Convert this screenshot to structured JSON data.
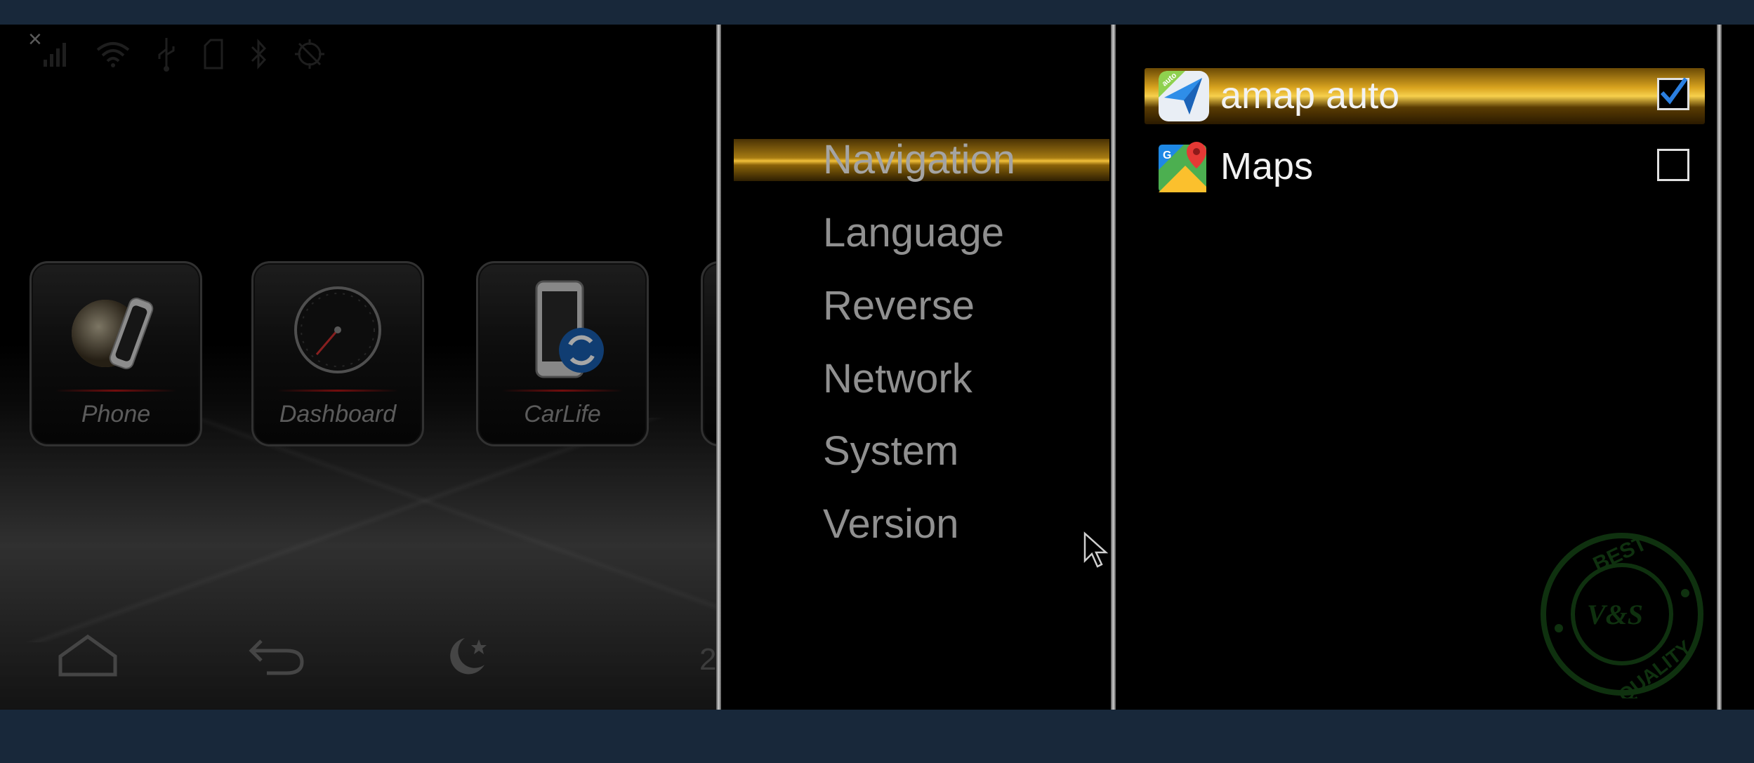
{
  "status_bar": {
    "close_glyph": "×",
    "icons": [
      "signal-icon",
      "wifi-icon",
      "usb-icon",
      "sd-card-icon",
      "bluetooth-icon",
      "no-gps-icon"
    ]
  },
  "launcher": {
    "tiles": [
      {
        "label": "Phone"
      },
      {
        "label": "Dashboard"
      },
      {
        "label": "CarLife"
      }
    ],
    "softkeys": [
      "home-icon",
      "back-icon",
      "night-mode-icon"
    ],
    "clock_fragment": "2"
  },
  "menu": {
    "items": [
      "Navigation",
      "Language",
      "Reverse",
      "Network",
      "System",
      "Version"
    ],
    "selected": "Navigation"
  },
  "navigation_apps": [
    {
      "name": "amap auto",
      "checked": true,
      "icon": "amap-auto-icon",
      "icon_badge": "auto"
    },
    {
      "name": "Maps",
      "checked": false,
      "icon": "google-maps-icon",
      "icon_badge": "G"
    }
  ],
  "watermark": {
    "top": "BEST",
    "center": "V&S",
    "bottom": "QUALITY"
  },
  "colors": {
    "highlight": "#e8b22a",
    "background": "#000000",
    "frame": "#18283a"
  }
}
